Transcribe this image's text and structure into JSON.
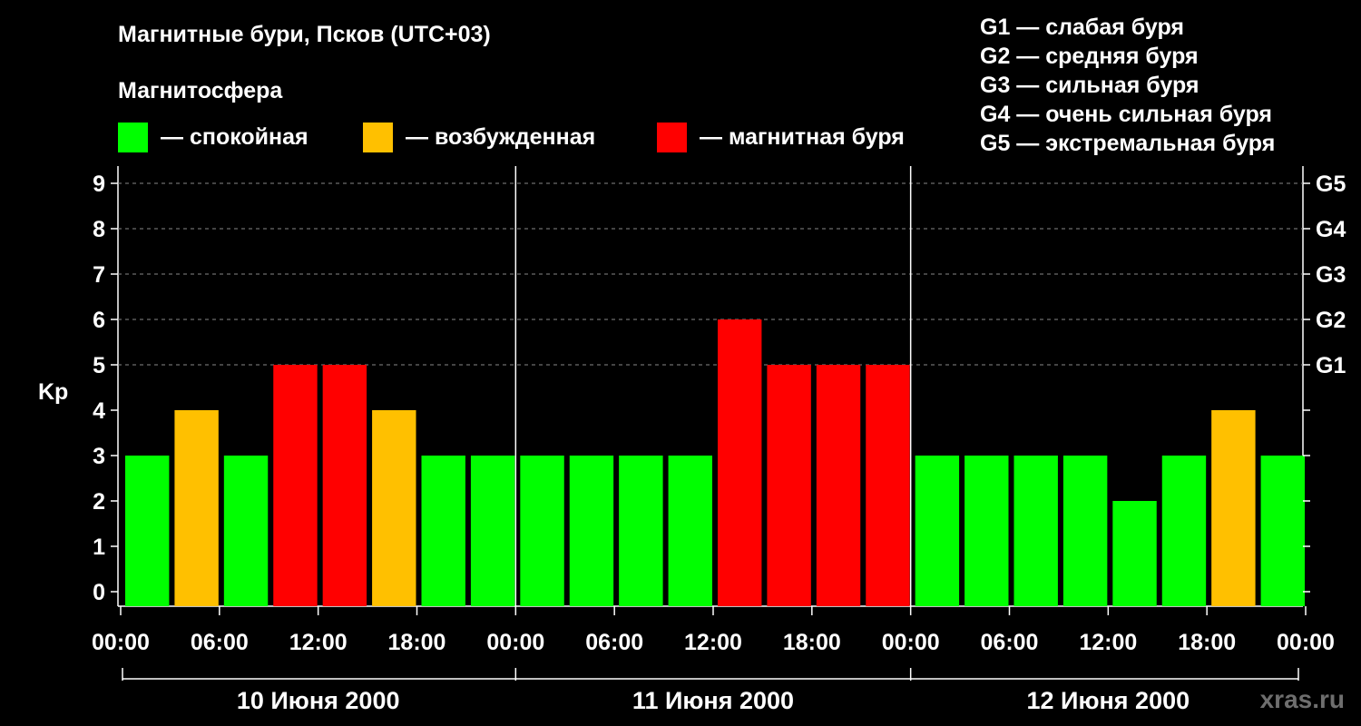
{
  "chart_data": {
    "type": "bar",
    "title": "Магнитные бури, Псков (UTC+03)",
    "subtitle": "Магнитосфера",
    "ylabel": "Kp",
    "ylim": [
      0,
      9
    ],
    "yticks": [
      "0",
      "1",
      "2",
      "3",
      "4",
      "5",
      "6",
      "7",
      "8",
      "9"
    ],
    "right_ticks": [
      {
        "value": 5,
        "label": "G1"
      },
      {
        "value": 6,
        "label": "G2"
      },
      {
        "value": 7,
        "label": "G3"
      },
      {
        "value": 8,
        "label": "G4"
      },
      {
        "value": 9,
        "label": "G5"
      }
    ],
    "grid": "dashed horizontal",
    "xticks": [
      "00:00",
      "06:00",
      "12:00",
      "18:00",
      "00:00",
      "06:00",
      "12:00",
      "18:00",
      "00:00",
      "06:00",
      "12:00",
      "18:00",
      "00:00"
    ],
    "days": [
      "10 Июня 2000",
      "11 Июня 2000",
      "12 Июня 2000"
    ],
    "interval_hours": 3,
    "values": [
      3,
      4,
      3,
      5,
      5,
      4,
      3,
      3,
      3,
      3,
      3,
      3,
      6,
      5,
      5,
      5,
      3,
      3,
      3,
      3,
      2,
      3,
      4,
      3
    ],
    "status_colors": {
      "calm": "#00ff00",
      "disturbed": "#ffc000",
      "storm": "#ff0000"
    },
    "legend": [
      {
        "label": "— спокойная",
        "color": "#00ff00"
      },
      {
        "label": "— возбужденная",
        "color": "#ffc000"
      },
      {
        "label": "— магнитная буря",
        "color": "#ff0000"
      }
    ],
    "g_scale": [
      "G1 — слабая буря",
      "G2 — средняя буря",
      "G3 — сильная буря",
      "G4 — очень сильная буря",
      "G5 — экстремальная буря"
    ]
  },
  "brand": "xras.ru"
}
